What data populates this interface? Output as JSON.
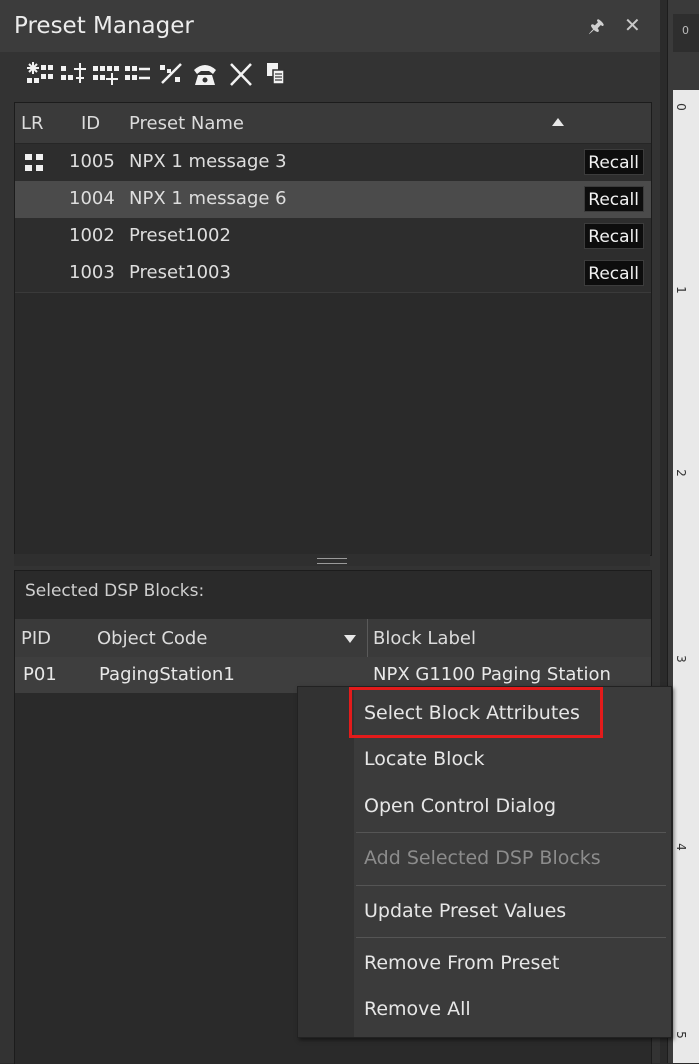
{
  "panel": {
    "title": "Preset Manager",
    "pin_icon": "pin-icon",
    "close_icon": "close-icon"
  },
  "toolbar": {
    "icons": [
      "new-preset-icon",
      "add-blocks-icon",
      "add-preset-icon",
      "remove-preset-icon",
      "edit-preset-icon",
      "paging-phone-icon",
      "delete-icon",
      "copy-preset-icon"
    ]
  },
  "preset_table": {
    "columns": [
      "LR",
      "ID",
      "Preset Name"
    ],
    "sort": "ascending",
    "rows": [
      {
        "id": "1005",
        "name": "NPX 1 message 3",
        "action": "Recall",
        "has_lr_icon": true
      },
      {
        "id": "1004",
        "name": "NPX 1 message 6",
        "action": "Recall",
        "selected": true
      },
      {
        "id": "1002",
        "name": "Preset1002",
        "action": "Recall"
      },
      {
        "id": "1003",
        "name": "Preset1003",
        "action": "Recall"
      }
    ]
  },
  "blocks": {
    "label": "Selected DSP Blocks:",
    "columns": [
      "PID",
      "Object Code",
      "Block Label"
    ],
    "row": {
      "pid": "P01",
      "object_code": "PagingStation1",
      "block_label": "NPX G1100 Paging Station"
    }
  },
  "context_menu": {
    "items": [
      {
        "label": "Select Block Attributes",
        "enabled": true,
        "highlighted": true
      },
      {
        "label": "Locate Block",
        "enabled": true
      },
      {
        "label": "Open Control Dialog",
        "enabled": true
      },
      {
        "label": "Add Selected DSP Blocks",
        "enabled": false
      },
      {
        "label": "Update Preset Values",
        "enabled": true
      },
      {
        "label": "Remove From Preset",
        "enabled": true
      },
      {
        "label": "Remove All",
        "enabled": true
      }
    ]
  },
  "ruler": {
    "tab_label": "0",
    "numbers": [
      "0",
      "1",
      "2",
      "3",
      "4",
      "5"
    ]
  },
  "colors": {
    "highlight_box": "#e31b1b",
    "selected_row": "#4b4b4b",
    "recall_button": "#0d0d0d"
  }
}
